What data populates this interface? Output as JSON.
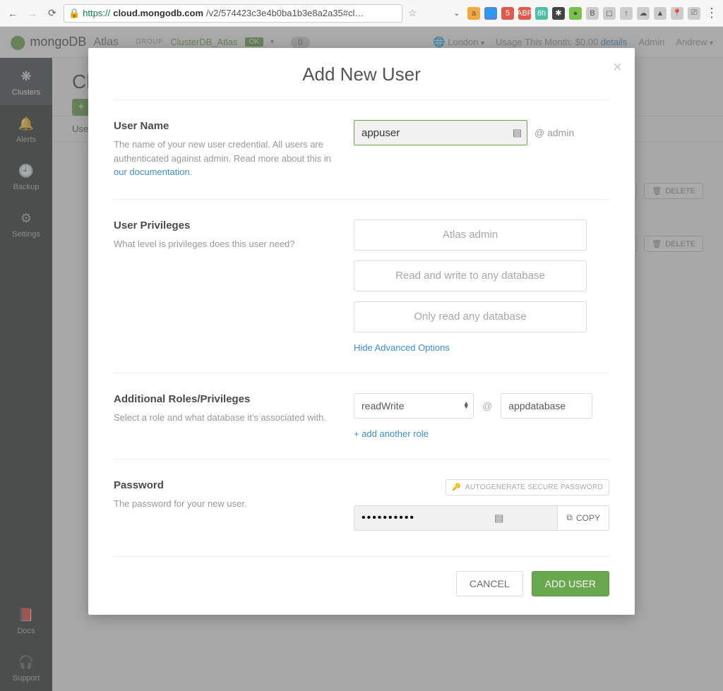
{
  "browser": {
    "url_scheme": "https://",
    "url_host": "cloud.mongodb.com",
    "url_rest": "/v2/574423c3e4b0ba1b3e8a2a35#cl…"
  },
  "header": {
    "brand": "mongoDB",
    "product": "Atlas",
    "group_label": "GROUP",
    "group_name": "ClusterDB_Atlas",
    "group_status": "OK",
    "count": "0",
    "region": "London",
    "usage_label": "Usage This Month:",
    "usage_amount": "$0.00",
    "details": "details",
    "admin": "Admin",
    "user": "Andrew"
  },
  "sidebar": {
    "items": [
      {
        "label": "Clusters",
        "icon": "❋"
      },
      {
        "label": "Alerts",
        "icon": "🔔"
      },
      {
        "label": "Backup",
        "icon": "🕘"
      },
      {
        "label": "Settings",
        "icon": "⚙"
      }
    ],
    "bottom": [
      {
        "label": "Docs",
        "icon": "📕"
      },
      {
        "label": "Support",
        "icon": "🎧"
      }
    ]
  },
  "page": {
    "title_prefix": "Cl",
    "tab_users": "Use",
    "row_btn_delete": "DELETE"
  },
  "modal": {
    "title": "Add New User",
    "username": {
      "label": "User Name",
      "help": "The name of your new user credential. All users are authenticated against admin. Read more about this in ",
      "help_link": "our documentation",
      "value": "appuser",
      "dbtag": "@ admin"
    },
    "privileges": {
      "label": "User Privileges",
      "help": "What level is privileges does this user need?",
      "options": [
        "Atlas admin",
        "Read and write to any database",
        "Only read any database"
      ],
      "toggle": "Hide Advanced Options"
    },
    "roles": {
      "label": "Additional Roles/Privileges",
      "help": "Select a role and what database it's associated with.",
      "role_value": "readWrite",
      "db_value": "appdatabase",
      "add": "+ add another role"
    },
    "password": {
      "label": "Password",
      "help": "The password for your new user.",
      "autogen": "AUTOGENERATE SECURE PASSWORD",
      "value": "••••••••••",
      "copy": "COPY"
    },
    "footer": {
      "cancel": "CANCEL",
      "submit": "ADD USER"
    }
  }
}
